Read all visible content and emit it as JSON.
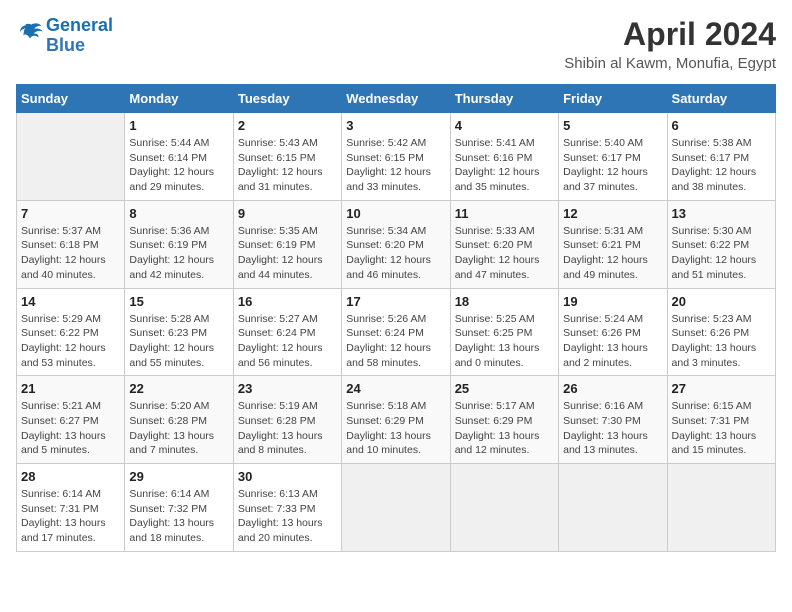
{
  "header": {
    "logo_line1": "General",
    "logo_line2": "Blue",
    "title": "April 2024",
    "subtitle": "Shibin al Kawm, Monufia, Egypt"
  },
  "weekdays": [
    "Sunday",
    "Monday",
    "Tuesday",
    "Wednesday",
    "Thursday",
    "Friday",
    "Saturday"
  ],
  "weeks": [
    [
      {
        "day": "",
        "info": ""
      },
      {
        "day": "1",
        "info": "Sunrise: 5:44 AM\nSunset: 6:14 PM\nDaylight: 12 hours\nand 29 minutes."
      },
      {
        "day": "2",
        "info": "Sunrise: 5:43 AM\nSunset: 6:15 PM\nDaylight: 12 hours\nand 31 minutes."
      },
      {
        "day": "3",
        "info": "Sunrise: 5:42 AM\nSunset: 6:15 PM\nDaylight: 12 hours\nand 33 minutes."
      },
      {
        "day": "4",
        "info": "Sunrise: 5:41 AM\nSunset: 6:16 PM\nDaylight: 12 hours\nand 35 minutes."
      },
      {
        "day": "5",
        "info": "Sunrise: 5:40 AM\nSunset: 6:17 PM\nDaylight: 12 hours\nand 37 minutes."
      },
      {
        "day": "6",
        "info": "Sunrise: 5:38 AM\nSunset: 6:17 PM\nDaylight: 12 hours\nand 38 minutes."
      }
    ],
    [
      {
        "day": "7",
        "info": "Sunrise: 5:37 AM\nSunset: 6:18 PM\nDaylight: 12 hours\nand 40 minutes."
      },
      {
        "day": "8",
        "info": "Sunrise: 5:36 AM\nSunset: 6:19 PM\nDaylight: 12 hours\nand 42 minutes."
      },
      {
        "day": "9",
        "info": "Sunrise: 5:35 AM\nSunset: 6:19 PM\nDaylight: 12 hours\nand 44 minutes."
      },
      {
        "day": "10",
        "info": "Sunrise: 5:34 AM\nSunset: 6:20 PM\nDaylight: 12 hours\nand 46 minutes."
      },
      {
        "day": "11",
        "info": "Sunrise: 5:33 AM\nSunset: 6:20 PM\nDaylight: 12 hours\nand 47 minutes."
      },
      {
        "day": "12",
        "info": "Sunrise: 5:31 AM\nSunset: 6:21 PM\nDaylight: 12 hours\nand 49 minutes."
      },
      {
        "day": "13",
        "info": "Sunrise: 5:30 AM\nSunset: 6:22 PM\nDaylight: 12 hours\nand 51 minutes."
      }
    ],
    [
      {
        "day": "14",
        "info": "Sunrise: 5:29 AM\nSunset: 6:22 PM\nDaylight: 12 hours\nand 53 minutes."
      },
      {
        "day": "15",
        "info": "Sunrise: 5:28 AM\nSunset: 6:23 PM\nDaylight: 12 hours\nand 55 minutes."
      },
      {
        "day": "16",
        "info": "Sunrise: 5:27 AM\nSunset: 6:24 PM\nDaylight: 12 hours\nand 56 minutes."
      },
      {
        "day": "17",
        "info": "Sunrise: 5:26 AM\nSunset: 6:24 PM\nDaylight: 12 hours\nand 58 minutes."
      },
      {
        "day": "18",
        "info": "Sunrise: 5:25 AM\nSunset: 6:25 PM\nDaylight: 13 hours\nand 0 minutes."
      },
      {
        "day": "19",
        "info": "Sunrise: 5:24 AM\nSunset: 6:26 PM\nDaylight: 13 hours\nand 2 minutes."
      },
      {
        "day": "20",
        "info": "Sunrise: 5:23 AM\nSunset: 6:26 PM\nDaylight: 13 hours\nand 3 minutes."
      }
    ],
    [
      {
        "day": "21",
        "info": "Sunrise: 5:21 AM\nSunset: 6:27 PM\nDaylight: 13 hours\nand 5 minutes."
      },
      {
        "day": "22",
        "info": "Sunrise: 5:20 AM\nSunset: 6:28 PM\nDaylight: 13 hours\nand 7 minutes."
      },
      {
        "day": "23",
        "info": "Sunrise: 5:19 AM\nSunset: 6:28 PM\nDaylight: 13 hours\nand 8 minutes."
      },
      {
        "day": "24",
        "info": "Sunrise: 5:18 AM\nSunset: 6:29 PM\nDaylight: 13 hours\nand 10 minutes."
      },
      {
        "day": "25",
        "info": "Sunrise: 5:17 AM\nSunset: 6:29 PM\nDaylight: 13 hours\nand 12 minutes."
      },
      {
        "day": "26",
        "info": "Sunrise: 6:16 AM\nSunset: 7:30 PM\nDaylight: 13 hours\nand 13 minutes."
      },
      {
        "day": "27",
        "info": "Sunrise: 6:15 AM\nSunset: 7:31 PM\nDaylight: 13 hours\nand 15 minutes."
      }
    ],
    [
      {
        "day": "28",
        "info": "Sunrise: 6:14 AM\nSunset: 7:31 PM\nDaylight: 13 hours\nand 17 minutes."
      },
      {
        "day": "29",
        "info": "Sunrise: 6:14 AM\nSunset: 7:32 PM\nDaylight: 13 hours\nand 18 minutes."
      },
      {
        "day": "30",
        "info": "Sunrise: 6:13 AM\nSunset: 7:33 PM\nDaylight: 13 hours\nand 20 minutes."
      },
      {
        "day": "",
        "info": ""
      },
      {
        "day": "",
        "info": ""
      },
      {
        "day": "",
        "info": ""
      },
      {
        "day": "",
        "info": ""
      }
    ]
  ]
}
